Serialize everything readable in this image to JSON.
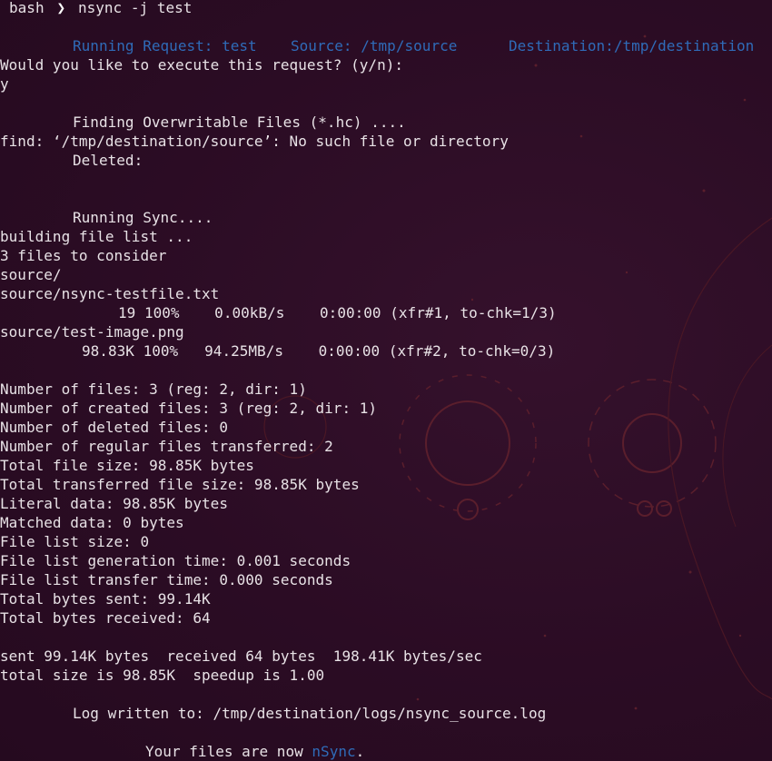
{
  "prompt": {
    "shell": "bash",
    "separator_icon": "chevron-right-icon",
    "command": "nsync -j test"
  },
  "request": {
    "running": "Running Request: test",
    "source": "Source: /tmp/source",
    "destination": "Destination:/tmp/destination"
  },
  "confirm": {
    "question": "Would you like to execute this request? (y/n):",
    "answer": "y"
  },
  "overwrite": {
    "finding": "Finding Overwritable Files (*.hc) ....",
    "find_error": "find: ‘/tmp/destination/source’: No such file or directory",
    "deleted": "Deleted:"
  },
  "sync": {
    "running": "Running Sync....",
    "building": "building file list ...",
    "consider": "3 files to consider",
    "dir": "source/",
    "file1": "source/nsync-testfile.txt",
    "file1_progress": "19 100%    0.00kB/s    0:00:00 (xfr#1, to-chk=1/3)",
    "file2": "source/test-image.png",
    "file2_progress": "98.83K 100%   94.25MB/s    0:00:00 (xfr#2, to-chk=0/3)"
  },
  "stats": [
    "Number of files: 3 (reg: 2, dir: 1)",
    "Number of created files: 3 (reg: 2, dir: 1)",
    "Number of deleted files: 0",
    "Number of regular files transferred: 2",
    "Total file size: 98.85K bytes",
    "Total transferred file size: 98.85K bytes",
    "Literal data: 98.85K bytes",
    "Matched data: 0 bytes",
    "File list size: 0",
    "File list generation time: 0.001 seconds",
    "File list transfer time: 0.000 seconds",
    "Total bytes sent: 99.14K",
    "Total bytes received: 64"
  ],
  "summary": {
    "sent": "sent 99.14K bytes  received 64 bytes  198.41K bytes/sec",
    "total": "total size is 98.85K  speedup is 1.00"
  },
  "log": "Log written to: /tmp/destination/logs/nsync_source.log",
  "final": {
    "prefix": "Your files are now ",
    "brand": "nSync",
    "suffix": "."
  },
  "colors": {
    "background": "#2c0d24",
    "text": "#e8e2e6",
    "accent_blue": "#2f6bb8",
    "wallpaper_lines": "#5a1e2c"
  }
}
